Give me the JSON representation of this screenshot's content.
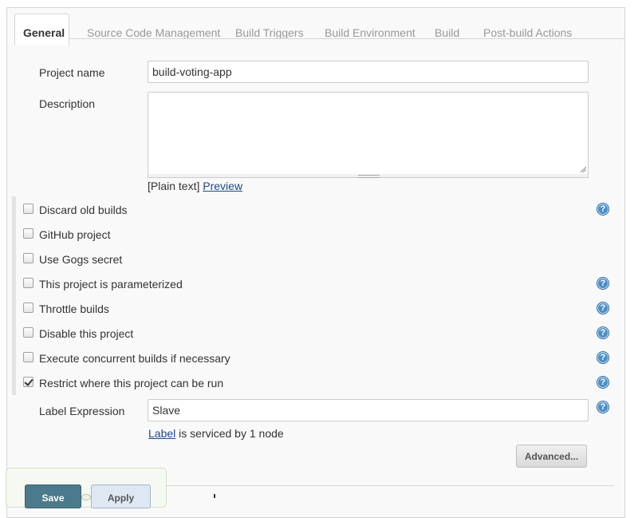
{
  "tabs": [
    {
      "label": "General",
      "active": true
    },
    {
      "label": "Source Code Management",
      "active": false
    },
    {
      "label": "Build Triggers",
      "active": false
    },
    {
      "label": "Build Environment",
      "active": false
    },
    {
      "label": "Build",
      "active": false
    },
    {
      "label": "Post-build Actions",
      "active": false
    }
  ],
  "project_name": {
    "label": "Project name",
    "value": "build-voting-app"
  },
  "description": {
    "label": "Description",
    "value": "",
    "format_prefix": "[Plain text]",
    "preview_link": "Preview"
  },
  "options": [
    {
      "label": "Discard old builds",
      "checked": false,
      "has_help": true
    },
    {
      "label": "GitHub project",
      "checked": false,
      "has_help": false
    },
    {
      "label": "Use Gogs secret",
      "checked": false,
      "has_help": false
    },
    {
      "label": "This project is parameterized",
      "checked": false,
      "has_help": true
    },
    {
      "label": "Throttle builds",
      "checked": false,
      "has_help": true
    },
    {
      "label": "Disable this project",
      "checked": false,
      "has_help": true
    },
    {
      "label": "Execute concurrent builds if necessary",
      "checked": false,
      "has_help": true
    },
    {
      "label": "Restrict where this project can be run",
      "checked": true,
      "has_help": true
    }
  ],
  "label_expression": {
    "label": "Label Expression",
    "value": "Slave",
    "link_text": "Label",
    "status_text": "is serviced by 1 node"
  },
  "buttons": {
    "advanced": "Advanced...",
    "save": "Save",
    "apply": "Apply"
  },
  "icons": {
    "help": "help-icon",
    "help_glyph": "?"
  },
  "colors": {
    "help": "#4a8ec8",
    "save": "#4a7a8c",
    "link": "#204a87"
  }
}
